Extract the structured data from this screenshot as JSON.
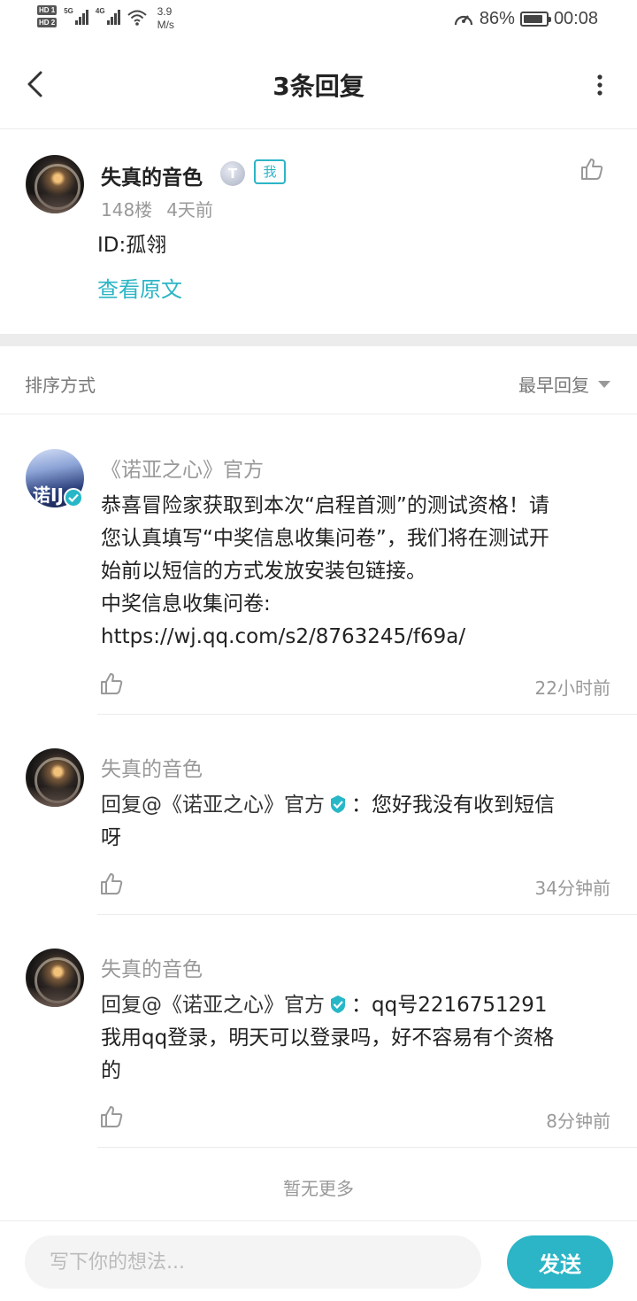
{
  "status_bar": {
    "sim1_label": "HD 1",
    "sim2_label": "HD 2",
    "network1": "5G",
    "network2": "4G",
    "speed_value": "3.9",
    "speed_unit": "M/s",
    "battery_percent": "86%",
    "battery_level": 0.86,
    "time": "00:08"
  },
  "header": {
    "title": "3条回复"
  },
  "main_comment": {
    "author": "失真的音色",
    "level_badge": "T",
    "me_badge": "我",
    "floor": "148楼",
    "time": "4天前",
    "text": "ID:孤翎",
    "view_original": "查看原文"
  },
  "sort": {
    "label": "排序方式",
    "selected": "最早回复"
  },
  "replies": [
    {
      "author": "《诺亚之心》官方",
      "avatar_text": "诺IJ",
      "lines": [
        "恭喜冒险家获取到本次“启程首测”的测试资格！请",
        "您认真填写“中奖信息收集问卷”，我们将在测试开",
        "始前以短信的方式发放安装包链接。",
        "中奖信息收集问卷:",
        "https://wj.qq.com/s2/8763245/f69a/"
      ],
      "time": "22小时前"
    },
    {
      "author": "失真的音色",
      "reply_prefix": "回复@《诺亚之心》官方",
      "lines": [
        "：您好我没有收到短信",
        "呀"
      ],
      "time": "34分钟前"
    },
    {
      "author": "失真的音色",
      "reply_prefix": "回复@《诺亚之心》官方",
      "lines": [
        "：qq号2216751291",
        "我用qq登录，明天可以登录吗，好不容易有个资格",
        "的"
      ],
      "time": "8分钟前"
    }
  ],
  "footer_note": "暂无更多",
  "composer": {
    "placeholder": "写下你的想法...",
    "send_label": "发送"
  },
  "colors": {
    "accent": "#2bb5c6",
    "text_primary": "#222222",
    "text_secondary": "#999999",
    "divider": "#ececec"
  },
  "icons": [
    "back-arrow-icon",
    "more-vertical-icon",
    "thumbs-up-icon",
    "verified-check-icon",
    "caret-down-icon",
    "battery-icon",
    "signal-icon",
    "wifi-icon",
    "speed-gauge-icon"
  ]
}
